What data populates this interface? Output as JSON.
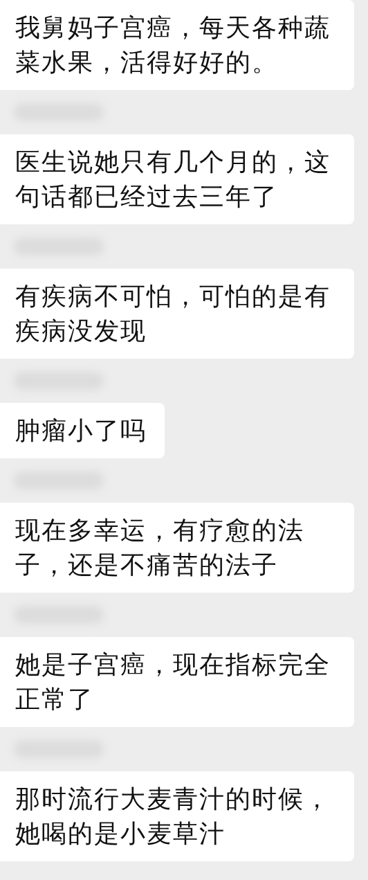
{
  "messages": [
    {
      "text": "我舅妈子宫癌，每天各种蔬菜水果，活得好好的。"
    },
    {
      "text": "医生说她只有几个月的，这句话都已经过去三年了"
    },
    {
      "text": "有疾病不可怕，可怕的是有疾病没发现"
    },
    {
      "text": "肿瘤小了吗"
    },
    {
      "text": "现在多幸运，有疗愈的法子，还是不痛苦的法子"
    },
    {
      "text": "她是子宫癌，现在指标完全正常了"
    },
    {
      "text": "那时流行大麦青汁的时候，她喝的是小麦草汁"
    }
  ]
}
